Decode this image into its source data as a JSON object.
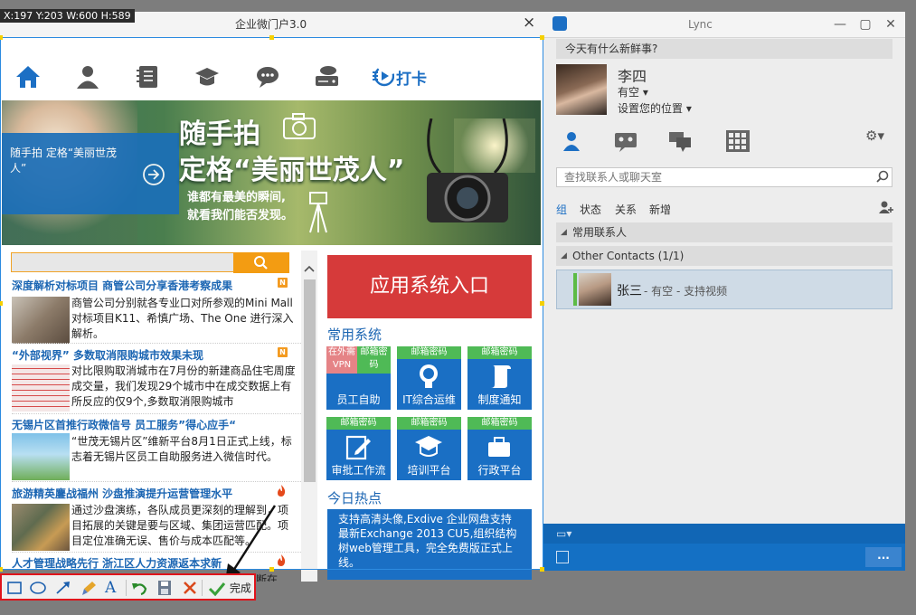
{
  "overlay": {
    "coords": "X:197 Y:203 W:600 H:589"
  },
  "portal": {
    "title": "企业微门户3.0",
    "close_label": "×",
    "checkin_label": "打卡",
    "banner": {
      "panel_text": "随手拍 定格“美丽世茂人”",
      "headline1": "随手拍",
      "headline2": "定格“美丽世茂人”",
      "subline1": "谁都有最美的瞬间,",
      "subline2": "就看我们能否发现。"
    },
    "news": [
      {
        "title": "深度解析对标项目 商管公司分享香港考察成果",
        "body": "商管公司分别就各专业口对所参观的Mini Mall对标项目K11、希慎广场、The One 进行深入解析。",
        "badge": "N"
      },
      {
        "title": "“外部视界” 多数取消限购城市效果未现",
        "body": "对比限购取消城市在7月份的新建商品住宅周度成交量，我们发现29个城市中在成交数据上有所反应的仅9个,多数取消限购城市",
        "badge": "N"
      },
      {
        "title": "无锡片区首推行政微信号 员工服务”得心应手“",
        "body": "“世茂无锡片区”维新平台8月1日正式上线，标志着无锡片区员工自助服务进入微信时代。",
        "badge": ""
      },
      {
        "title": "旅游精英鏖战福州 沙盘推演提升运营管理水平",
        "body": "通过沙盘演练，各队成员更深刻的理解到，项目拓展的关键是要与区域、集团运营匹配。项目定位准确无误、售价与成本匹配等。",
        "badge": "hot"
      },
      {
        "title": "人才管理战略先行 浙江区人力资源返本求新",
        "body": "管理人员需要通过企业的发展阶段来判断在",
        "badge": "hot"
      }
    ],
    "app_entry_label": "应用系统入口",
    "common_systems_title": "常用系统",
    "tiles": [
      {
        "top": "",
        "top_split": [
          "在外需VPN",
          "邮箱密码"
        ],
        "label": "员工自助"
      },
      {
        "top": "邮箱密码",
        "label": "IT综合运维"
      },
      {
        "top": "邮箱密码",
        "label": "制度通知"
      },
      {
        "top": "邮箱密码",
        "label": "审批工作流"
      },
      {
        "top": "邮箱密码",
        "label": "培训平台"
      },
      {
        "top": "邮箱密码",
        "label": "行政平台"
      }
    ],
    "hot_title": "今日热点",
    "hot_text": "支持高清头像,Exdive 企业网盘支持最新Exchange 2013 CU5,组织结构树web管理工具，完全免费版正式上线。"
  },
  "lync": {
    "title": "Lync",
    "whats_new": "今天有什么新鲜事?",
    "user_name": "李四",
    "presence": "有空 ▾",
    "location": "设置您的位置 ▾",
    "search_placeholder": "查找联系人或聊天室",
    "tabs": [
      "组",
      "状态",
      "关系",
      "新增"
    ],
    "groups": [
      "常用联系人",
      "Other Contacts (1/1)"
    ],
    "contact": {
      "name": "张三",
      "detail": " - 有空 - 支持视频"
    },
    "more_label": "..."
  },
  "toolbar": {
    "done_label": "完成"
  },
  "colors": {
    "brand_blue": "#1a6fc4",
    "tile_green": "#4fba56",
    "entry_red": "#d63a3a",
    "toolbar_border": "#e0141b"
  }
}
